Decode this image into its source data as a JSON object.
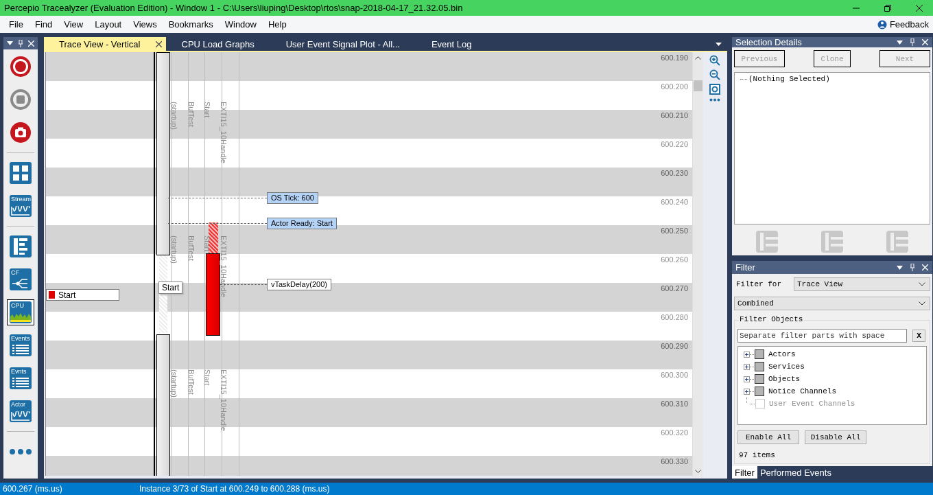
{
  "window": {
    "title": "Percepio Tracealyzer (Evaluation Edition) - Window 1 - C:\\Users\\liuping\\Desktop\\rtos\\snap-2018-04-17_21.32.05.bin"
  },
  "menu": [
    "File",
    "Find",
    "View",
    "Layout",
    "Views",
    "Bookmarks",
    "Window",
    "Help"
  ],
  "feedback": "Feedback",
  "toolbar": [
    {
      "kind": "record",
      "selected": false
    },
    {
      "kind": "stop",
      "selected": false
    },
    {
      "kind": "snapshot",
      "selected": false
    },
    {
      "kind": "separator"
    },
    {
      "kind": "grid",
      "selected": false
    },
    {
      "kind": "wave",
      "label": "Stream",
      "selected": false
    },
    {
      "kind": "separator"
    },
    {
      "kind": "trace",
      "selected": false
    },
    {
      "kind": "flow",
      "label": "CF",
      "selected": false
    },
    {
      "kind": "cpu",
      "label": "CPU",
      "selected": true
    },
    {
      "kind": "list",
      "label": "Events",
      "selected": false
    },
    {
      "kind": "list",
      "label": "Evnts",
      "selected": false
    },
    {
      "kind": "wave",
      "label": "Actor",
      "selected": false
    },
    {
      "kind": "separator"
    },
    {
      "kind": "more",
      "selected": false
    }
  ],
  "tabs": [
    {
      "label": "Trace View - Vertical",
      "selected": true
    },
    {
      "label": "CPU Load Graphs",
      "selected": false
    },
    {
      "label": "User Event Signal Plot - All...",
      "selected": false
    },
    {
      "label": "Event Log",
      "selected": false
    }
  ],
  "trace": {
    "ticks": [
      "600.190",
      "600.200",
      "600.210",
      "600.220",
      "600.230",
      "600.240",
      "600.250",
      "600.260",
      "600.270",
      "600.280",
      "600.290",
      "600.300",
      "600.310",
      "600.320",
      "600.330"
    ],
    "lane_labels": [
      [
        "(startup)",
        "BufTest",
        "Start",
        "EXTI15_10Handle"
      ],
      [
        "(startup)",
        "BufTest",
        "Start",
        "EXTI15_10Handle"
      ],
      [
        "(startup)",
        "BufTest",
        "Start",
        "EXTI15_10Handle"
      ]
    ],
    "actor_label": "Start",
    "actor_popup": "Start",
    "annotations": [
      {
        "kind": "event",
        "text": "OS Tick: 600"
      },
      {
        "kind": "event",
        "text": "Actor Ready: Start"
      },
      {
        "kind": "service",
        "text": "vTaskDelay(200)"
      }
    ]
  },
  "selection_details": {
    "title": "Selection Details",
    "buttons": [
      {
        "label": "Previous",
        "disabled": true
      },
      {
        "label": "Clone",
        "disabled": true
      },
      {
        "label": "Next",
        "disabled": true
      }
    ],
    "tree": [
      "(Nothing Selected)"
    ]
  },
  "filter": {
    "title": "Filter",
    "filter_for_label": "Filter for",
    "filter_for": "Trace View",
    "mode": "Combined",
    "group": "Filter Objects",
    "search": {
      "placeholder": "Separate filter parts with space"
    },
    "clear": "x",
    "items": [
      {
        "label": "Actors",
        "expandable": true,
        "mixed": true,
        "disabled": false
      },
      {
        "label": "Services",
        "expandable": true,
        "mixed": true,
        "disabled": false
      },
      {
        "label": "Objects",
        "expandable": true,
        "mixed": true,
        "disabled": false
      },
      {
        "label": "Notice Channels",
        "expandable": true,
        "mixed": true,
        "disabled": false
      },
      {
        "label": "User Event Channels",
        "expandable": false,
        "mixed": false,
        "disabled": true
      }
    ],
    "buttons": [
      "Enable All",
      "Disable All"
    ],
    "count": "97 items"
  },
  "panel_tabs": [
    {
      "label": "Filter",
      "selected": true
    },
    {
      "label": "Performed Events",
      "selected": false
    }
  ],
  "status_bar": {
    "time": "600.267 (ms.us)",
    "instance": "Instance 3/73 of Start at 600.249 to 600.288 (ms.us)"
  }
}
